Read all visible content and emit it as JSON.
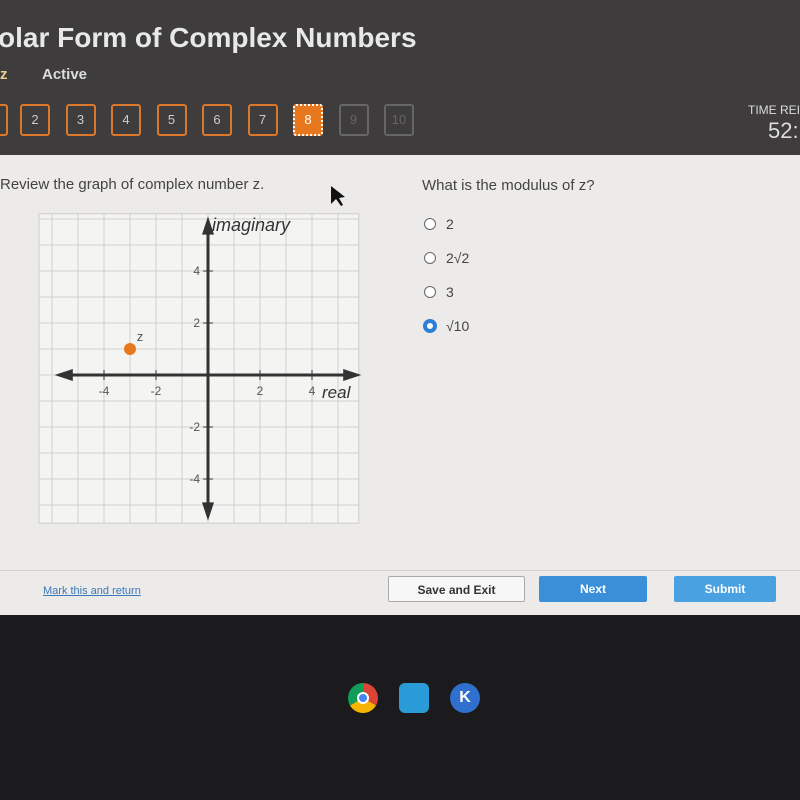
{
  "header": {
    "title": "olar Form of Complex Numbers",
    "type_label": "z",
    "status": "Active",
    "time_label": "TIME REI",
    "time_value": "52:"
  },
  "question_nav": [
    {
      "label": "2",
      "state": "answered"
    },
    {
      "label": "3",
      "state": "answered"
    },
    {
      "label": "4",
      "state": "answered"
    },
    {
      "label": "5",
      "state": "answered"
    },
    {
      "label": "6",
      "state": "answered"
    },
    {
      "label": "7",
      "state": "answered"
    },
    {
      "label": "8",
      "state": "current"
    },
    {
      "label": "9",
      "state": "unanswered"
    },
    {
      "label": "10",
      "state": "unanswered"
    }
  ],
  "prompt": "Review the graph of complex number z.",
  "question": "What is the modulus of z?",
  "options": [
    {
      "label": "2",
      "selected": false
    },
    {
      "label": "2√2",
      "selected": false
    },
    {
      "label": "3",
      "selected": false
    },
    {
      "label": "√10",
      "selected": true
    }
  ],
  "chart_data": {
    "type": "scatter",
    "xlabel": "real",
    "ylabel": "imaginary",
    "xlim": [
      -6,
      6
    ],
    "ylim": [
      -6,
      6
    ],
    "grid": true,
    "xticks": [
      "-4",
      "-2",
      "2",
      "4"
    ],
    "yticks": [
      "4",
      "2",
      "-2",
      "-4"
    ],
    "points": [
      {
        "label": "z",
        "x": -3,
        "y": 1,
        "color": "#e8781e"
      }
    ]
  },
  "footer": {
    "mark_link": "Mark this and return",
    "save_exit": "Save and Exit",
    "next": "Next",
    "submit": "Submit"
  },
  "colors": {
    "accent": "#e8781e",
    "primary_button": "#3b8ed8"
  }
}
